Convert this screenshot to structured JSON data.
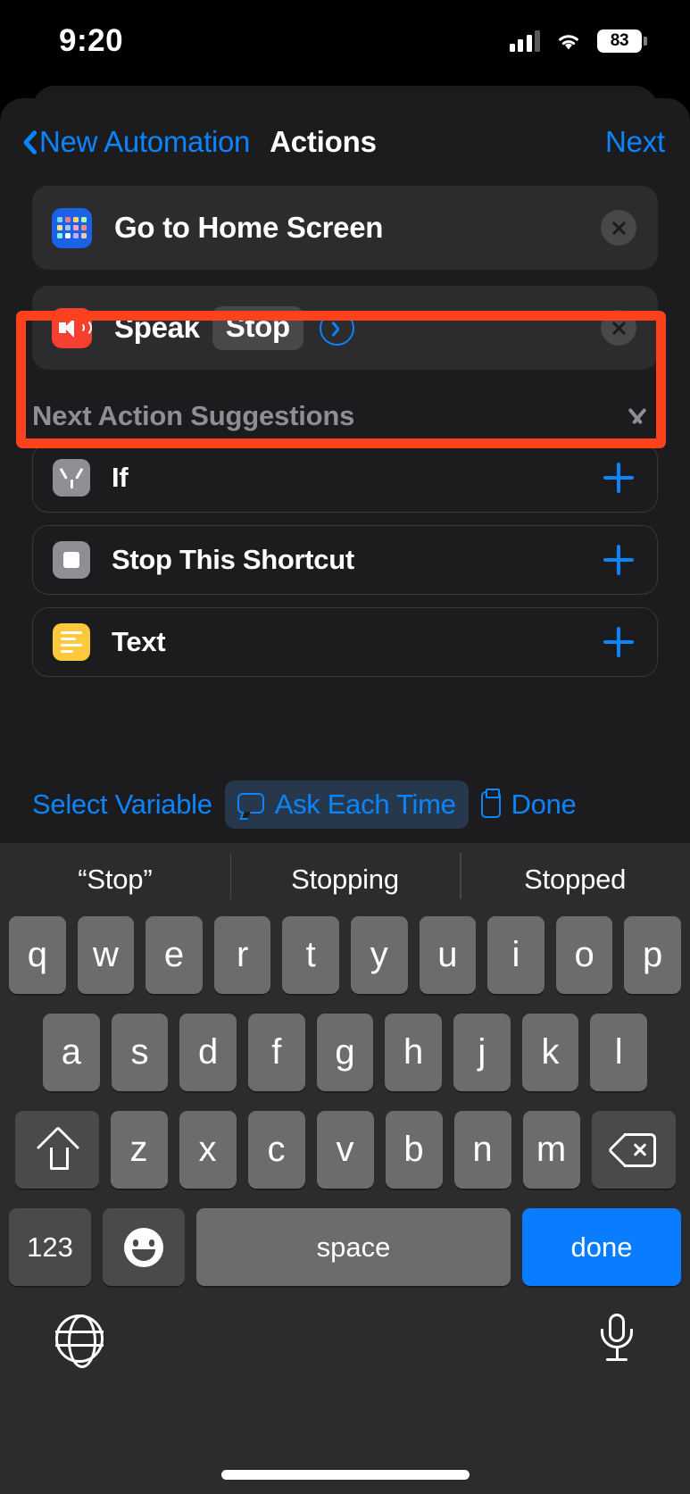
{
  "status_bar": {
    "time": "9:20",
    "battery_percent": "83",
    "signal_icon": "cellular-signal-icon",
    "wifi_icon": "wifi-icon",
    "battery_icon": "battery-icon"
  },
  "nav": {
    "back_label": "New Automation",
    "title": "Actions",
    "next_label": "Next",
    "back_icon": "chevron-left-icon"
  },
  "actions": [
    {
      "label": "Go to Home Screen",
      "icon": "home-screen-grid-icon",
      "icon_color": "#1a63e8",
      "remove_icon": "close-circle-icon",
      "token": null,
      "has_detail_chevron": false,
      "highlighted": false
    },
    {
      "label": "Speak",
      "icon": "speaker-wave-icon",
      "icon_color": "#f43f31",
      "remove_icon": "close-circle-icon",
      "token": "Stop",
      "has_detail_chevron": true,
      "detail_icon": "chevron-right-circle-icon",
      "highlighted": true,
      "highlight_color": "#fc421c"
    }
  ],
  "suggestions": {
    "title": "Next Action Suggestions",
    "collapse_icon": "chevron-down-icon",
    "items": [
      {
        "label": "If",
        "icon": "branch-icon",
        "icon_color": "#8e8e93",
        "add_icon": "plus-icon"
      },
      {
        "label": "Stop This Shortcut",
        "icon": "stop-square-icon",
        "icon_color": "#8e8e93",
        "add_icon": "plus-icon"
      },
      {
        "label": "Text",
        "icon": "text-lines-icon",
        "icon_color": "#ffc83d",
        "add_icon": "plus-icon"
      }
    ]
  },
  "variable_toolbar": {
    "select_variable": "Select Variable",
    "ask_each_time": "Ask Each Time",
    "ask_each_time_icon": "speech-bubble-icon",
    "clipboard_icon": "clipboard-icon",
    "done": "Done",
    "accent_color": "#0a84ff"
  },
  "keyboard": {
    "predictions": [
      "“Stop”",
      "Stopping",
      "Stopped"
    ],
    "row1": [
      "q",
      "w",
      "e",
      "r",
      "t",
      "y",
      "u",
      "i",
      "o",
      "p"
    ],
    "row2": [
      "a",
      "s",
      "d",
      "f",
      "g",
      "h",
      "j",
      "k",
      "l"
    ],
    "row3": [
      "z",
      "x",
      "c",
      "v",
      "b",
      "n",
      "m"
    ],
    "shift_icon": "shift-icon",
    "backspace_icon": "backspace-icon",
    "numbers_key": "123",
    "emoji_icon": "emoji-smiley-icon",
    "space_key": "space",
    "done_key": "done",
    "done_key_color": "#0a7cff",
    "globe_icon": "globe-icon",
    "mic_icon": "microphone-icon",
    "home_indicator": "home-indicator"
  }
}
